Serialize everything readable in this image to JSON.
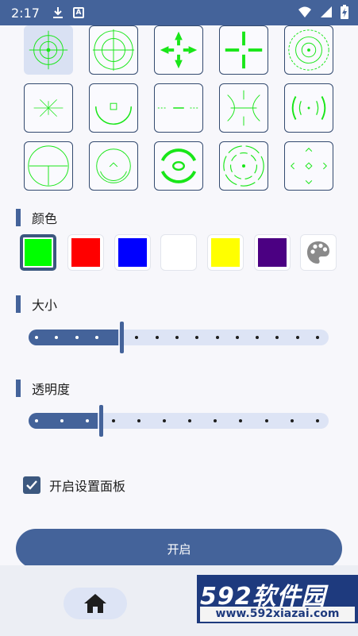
{
  "status_bar": {
    "time": "2:17",
    "icons": [
      "download-icon",
      "a-badge-icon",
      "wifi-icon",
      "signal-icon",
      "battery-charging-icon"
    ]
  },
  "crosshairs": {
    "selected_index": 0,
    "icons": [
      "crosshair-scope-icon",
      "crosshair-circle-cross-icon",
      "crosshair-four-arrows-icon",
      "crosshair-plus-icon",
      "crosshair-concentric-icon",
      "crosshair-asterisk-icon",
      "crosshair-bowl-square-icon",
      "crosshair-dashed-line-icon",
      "crosshair-butterfly-icon",
      "crosshair-brackets-icon",
      "crosshair-circle-line-icon",
      "crosshair-arc-chevron-icon",
      "crosshair-bold-arcs-icon",
      "crosshair-broken-ring-icon",
      "crosshair-diamond-chevrons-icon"
    ]
  },
  "color_section": {
    "title": "颜色",
    "selected_index": 0,
    "swatches": [
      "#00ff00",
      "#ff0000",
      "#0000ff",
      "#ffffff",
      "#ffff00",
      "#4b0082"
    ],
    "picker_icon": "palette-icon"
  },
  "size_section": {
    "title": "大小",
    "value": 0.31,
    "stops": 15
  },
  "opacity_section": {
    "title": "透明度",
    "value": 0.24,
    "stops": 12
  },
  "settings_panel": {
    "label": "开启设置面板",
    "checked": true
  },
  "primary_action": {
    "label": "开启"
  },
  "bottom_nav": {
    "home_icon": "home-icon"
  },
  "watermark": {
    "brand": "592软件园",
    "url": "www.592xiazai.com"
  }
}
